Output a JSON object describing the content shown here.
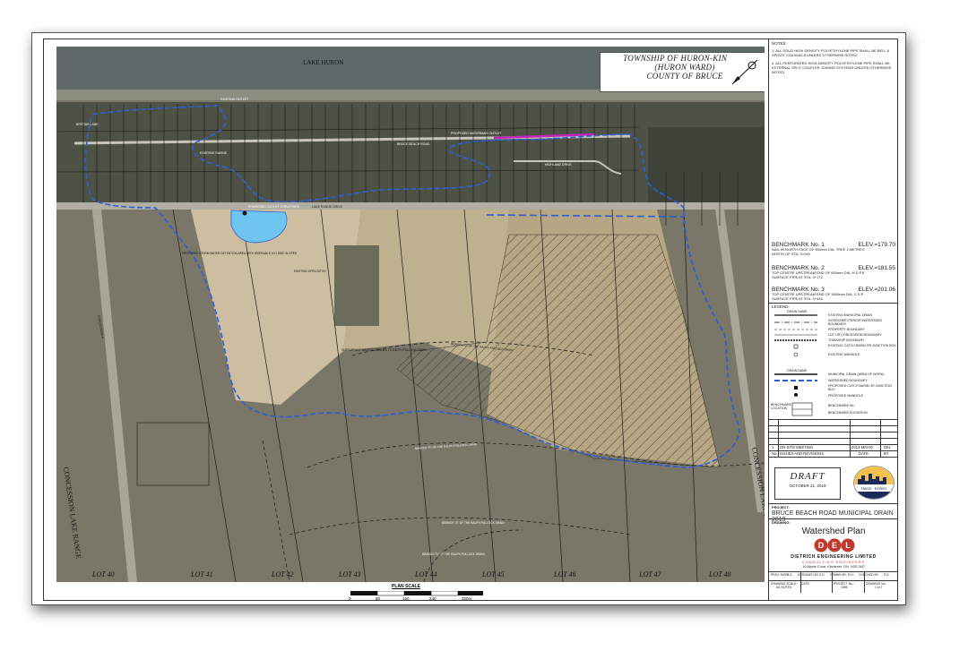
{
  "map": {
    "lake_label": "LAKE HURON",
    "title_lines": [
      "TOWNSHIP OF HURON-KINLOSS",
      "(HURON WARD)",
      "COUNTY OF BRUCE"
    ],
    "roads": {
      "bruce_beach_road": "BRUCE BEACH ROAD",
      "lake_range_drive": "LAKE RANGE DRIVE",
      "highland_drive": "HIGHLAND DRIVE",
      "concession_a": "CONCESSION A",
      "concession_lake_range_left": "CONCESSION LAKE RANGE",
      "concession_lake_range_right": "CONCESSION LAKE RANGE",
      "shore_lane": "BRITTAS LANE"
    },
    "callouts": {
      "existing_outlet": "EXISTING OUTLET",
      "existing_ravine": "EXISTING RAVINE",
      "proposed_outlet_structure": "PROPOSED OUTLET STRUCTURE",
      "proposed_watermain": "PROPOSED WATERMAIN OUTLET",
      "proposed_storm_water": "PROPOSED STORM WATER DETENTION AREA WITH WORKABLE 10:1 SIDE SLOPES",
      "existing_open_ditch": "EXISTING OPEN DITCH",
      "subsurface_waters": "SUBSURFACE WATERS DRAINED TO RALPH POLLOCK DRAIN",
      "branch_c": "BRANCH \"C\" OF THE RALPH POLLOCK DRAIN",
      "branch_b": "BRANCH \"B\" OF THE RALPH POLLOCK DRAIN",
      "branch_a": "BRANCH \"A\" OF THE RALPH POLLOCK DRAIN",
      "branch_d": "BRANCH \"D\" OF THE RALPH POLLOCK DRAIN"
    },
    "lots": [
      "LOT 40",
      "LOT 41",
      "LOT 42",
      "LOT 43",
      "LOT 44",
      "LOT 45",
      "LOT 46",
      "LOT 47",
      "LOT 48"
    ],
    "colors": {
      "watershed": "#2a5fd6",
      "detention_pond": "#6ec6f0",
      "watermain": "#c026b8"
    }
  },
  "scale": {
    "label": "PLAN SCALE",
    "ticks": [
      "0",
      "80",
      "160",
      "240",
      "320m"
    ]
  },
  "panel": {
    "notes_heading": "NOTES:",
    "notes": [
      "1. ALL SOLID HIGH DENSITY POLYETHYLENE PIPE SHALL BE BELL & SPIGOT CSA B182.8 UNLESS OTHERWISE NOTED.",
      "2. ALL PERFORATED HIGH DENSITY POLYETHYLENE PIPE SHALL BE EXTERNAL SPLIT COUPLER JOINING SYSTEMS UNLESS OTHERWISE NOTED."
    ],
    "benchmarks": [
      {
        "name": "BENCHMARK No. 1",
        "elev": "ELEV.=179.70",
        "desc": "NAIL IN NORTH FACE OF 600mm DIA. TREE 2 METRES NORTH OF STA. 0+040"
      },
      {
        "name": "BENCHMARK No. 2",
        "elev": "ELEV.=181.55",
        "desc": "TOP CENTRE UPSTREAM END OF 600mm DIA. H.D.P.E. SURFACE PIPE AT STA. 0+172"
      },
      {
        "name": "BENCHMARK No. 3",
        "elev": "ELEV.=201.06",
        "desc": "TOP CENTRE UPSTREAM END OF 1800mm DIA. C.S.P. SURFACE PIPE AT STA. 0+440"
      }
    ],
    "legend_heading": "LEGEND:",
    "legend": [
      "EXISTING MUNICIPAL DRAIN",
      "INTERIOR/EXTERIOR WATERSHED BOUNDARY",
      "PROPERTY BOUNDARY",
      "LOT OR CONCESSION BOUNDARY",
      "TOWNSHIP BOUNDARY",
      "EXISTING CATCH BASIN OR JUNCTION BOX",
      "EXISTING MANHOLE",
      "MUNICIPAL DRAIN (AREA OF WORK)",
      "WATERSHED BOUNDARY",
      "PROPOSED CATCH BASIN OR JUNCTION BOX",
      "PROPOSED MANHOLE",
      "BENCHMARK No.",
      "BENCHMARK ELEVATION"
    ],
    "legend_drain_name": "DRAIN NAME",
    "legend_bm_location": "BENCHMARK LOCATION",
    "revision": {
      "no": "1.",
      "desc": "ON-SITE MEETING",
      "date": "2013-MM-00",
      "by": "DEL"
    },
    "revision_header": {
      "no": "No.",
      "desc": "ISSUES AND REVISIONS",
      "date": "DATE",
      "by": "BY"
    },
    "draft": {
      "title": "DRAFT",
      "date": "OCTOBER 21, 2019"
    },
    "logo_text": "Huron - Kinloss",
    "project_label": "PROJECT:",
    "project": "BRUCE BEACH ROAD MUNICIPAL DRAIN 2019",
    "drawing_label": "DRAWING:",
    "drawing": "Watershed Plan",
    "firm_logo": "DEL",
    "firm": "DIETRICH ENGINEERING LIMITED",
    "firm_sub": "CONSULTING ENGINEERS",
    "address": "10 Alpine Court, Kitchener, ON, N2E 2M7",
    "title_block": {
      "row1": [
        "PROJ. MGR:",
        "S.D.",
        "DESIGNED BY:",
        "S.D.",
        "DRAWN BY:",
        "R.H.",
        "CHECKED BY:",
        "S.D."
      ],
      "row2": [
        "DRAWING SCALE:",
        "AS NOTED",
        "DATE:",
        "",
        "PROJECT No.:",
        "1956",
        "DRAWING No.:",
        "1 of 7"
      ]
    }
  }
}
